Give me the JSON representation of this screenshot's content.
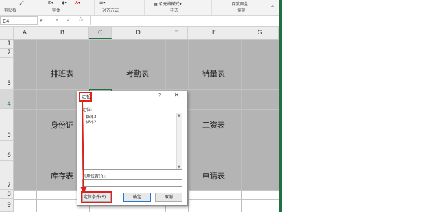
{
  "ribbon": {
    "groups": [
      "剪贴板",
      "字体",
      "对齐方式",
      "样式",
      "保存"
    ],
    "style_button": "单元格样式",
    "save_button": "百度网盘"
  },
  "formula_bar": {
    "name_box": "C4",
    "fx": "fx"
  },
  "columns": [
    "A",
    "B",
    "C",
    "D",
    "E",
    "F",
    "G"
  ],
  "rows": [
    "1",
    "2",
    "3",
    "4",
    "5",
    "6",
    "7",
    "8",
    "9"
  ],
  "cells": {
    "b3": "排班表",
    "d3": "考勤表",
    "f3": "销量表",
    "b5": "身份证",
    "f5": "工资表",
    "b7": "库存表",
    "f7": "申请表"
  },
  "dialog": {
    "title": "定位",
    "help": "?",
    "close": "×",
    "goto_label": "定位:",
    "goto_items": [
      "$B$3",
      "$B$2"
    ],
    "ref_label": "引用位置(R):",
    "ref_value": "",
    "special_button": "定位条件(S)...",
    "ok_button": "确定",
    "cancel_button": "取消"
  },
  "colors": {
    "accent": "#217346",
    "highlight_red": "#e0201a",
    "selection_gray": "#b4b4b4"
  }
}
